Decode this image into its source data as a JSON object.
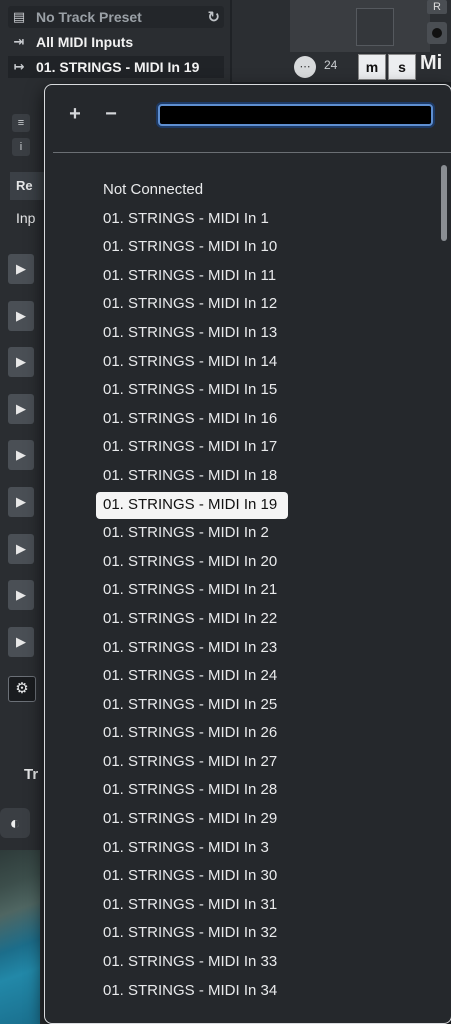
{
  "inspector": {
    "preset_label": "No Track Preset",
    "input_label": "All MIDI Inputs",
    "routing_label": "01. STRINGS - MIDI In 19",
    "tab_partial": "Re",
    "inputs_partial": "Inp",
    "bottom_partial": "Tr"
  },
  "track_header": {
    "track_number": "24",
    "mute_label": "m",
    "solo_label": "s",
    "name_partial": "Mi",
    "r_label": "R"
  },
  "popup": {
    "add_label": "+",
    "remove_label": "−",
    "search_value": "",
    "items": [
      "Not Connected",
      "01. STRINGS - MIDI In 1",
      "01. STRINGS - MIDI In 10",
      "01. STRINGS - MIDI In 11",
      "01. STRINGS - MIDI In 12",
      "01. STRINGS - MIDI In 13",
      "01. STRINGS - MIDI In 14",
      "01. STRINGS - MIDI In 15",
      "01. STRINGS - MIDI In 16",
      "01. STRINGS - MIDI In 17",
      "01. STRINGS - MIDI In 18",
      "01. STRINGS - MIDI In 19",
      "01. STRINGS - MIDI In 2",
      "01. STRINGS - MIDI In 20",
      "01. STRINGS - MIDI In 21",
      "01. STRINGS - MIDI In 22",
      "01. STRINGS - MIDI In 23",
      "01. STRINGS - MIDI In 24",
      "01. STRINGS - MIDI In 25",
      "01. STRINGS - MIDI In 26",
      "01. STRINGS - MIDI In 27",
      "01. STRINGS - MIDI In 28",
      "01. STRINGS - MIDI In 29",
      "01. STRINGS - MIDI In 3",
      "01. STRINGS - MIDI In 30",
      "01. STRINGS - MIDI In 31",
      "01. STRINGS - MIDI In 32",
      "01. STRINGS - MIDI In 33",
      "01. STRINGS - MIDI In 34"
    ],
    "selected_item": "01. STRINGS - MIDI In 19"
  },
  "colors": {
    "popup_bg": "#25282c",
    "selection_bg": "#f4f4f4",
    "search_focus": "#5f8fd0"
  }
}
